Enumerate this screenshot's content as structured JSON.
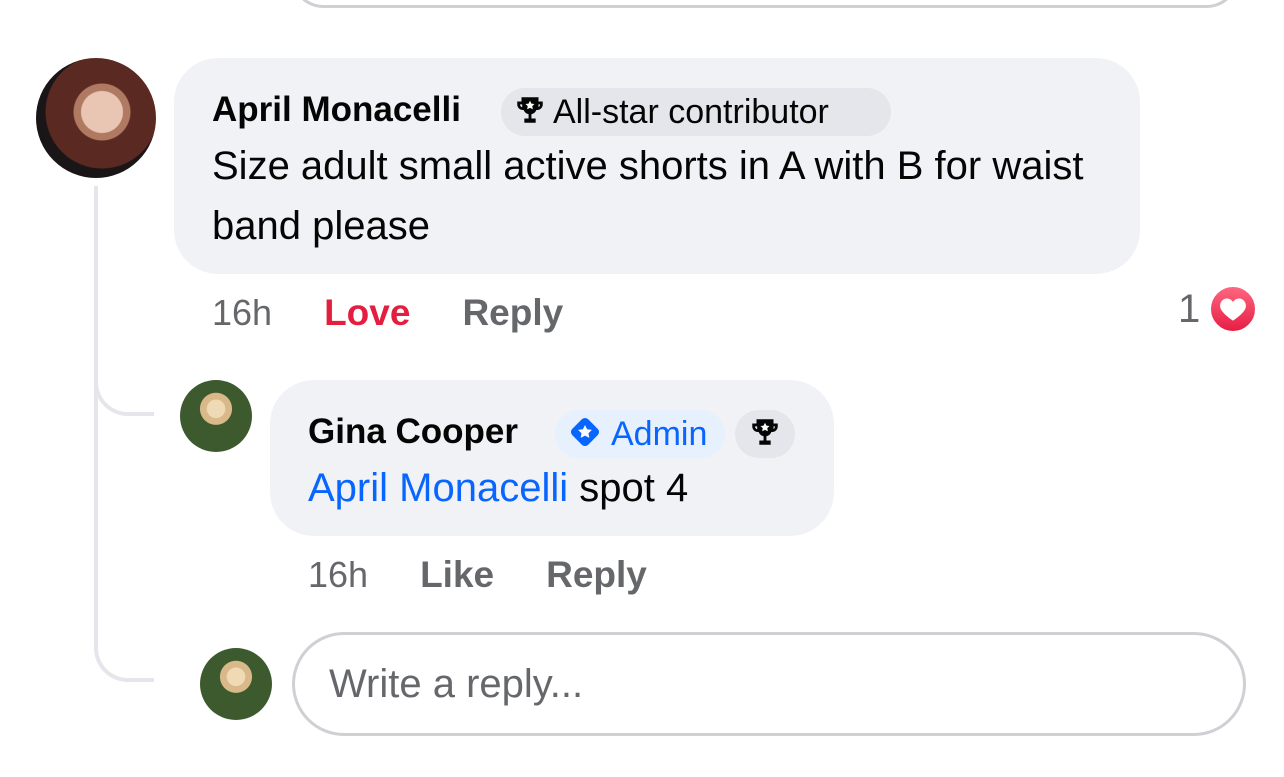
{
  "comment": {
    "author": "April Monacelli",
    "badge": {
      "icon": "trophy-icon",
      "label": "All-star contributor"
    },
    "text": "Size adult small active shorts in A with B for waist band please",
    "time": "16h",
    "love_label": "Love",
    "reply_label": "Reply",
    "reaction": {
      "count": "1",
      "icon": "heart-reaction-icon",
      "color": "#e41e3f"
    }
  },
  "reply": {
    "author": "Gina Cooper",
    "badge": {
      "icon": "admin-diamond-icon",
      "label": "Admin",
      "color": "#0866ff"
    },
    "extra_badge_icon": "trophy-icon",
    "mention": "April Monacelli",
    "text": "spot 4",
    "time": "16h",
    "like_label": "Like",
    "reply_label": "Reply"
  },
  "reply_box": {
    "placeholder": "Write a reply..."
  }
}
